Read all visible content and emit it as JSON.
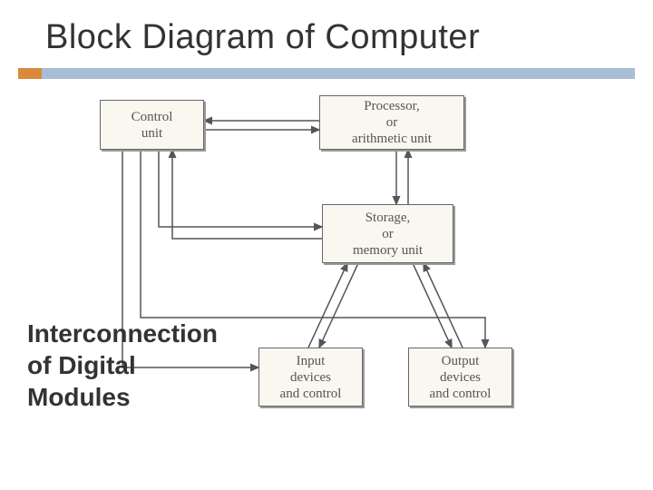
{
  "title": "Block Diagram of Computer",
  "subtitle": "Interconnection of Digital Modules",
  "blocks": {
    "control": "Control\nunit",
    "processor": "Processor,\nor\narithmetic unit",
    "storage": "Storage,\nor\nmemory unit",
    "input": "Input\ndevices\nand control",
    "output": "Output\ndevices\nand control"
  },
  "connections": [
    {
      "from": "processor",
      "to": "control",
      "bidirectional": true
    },
    {
      "from": "control",
      "to": "storage",
      "bidirectional": true
    },
    {
      "from": "control",
      "to": "input",
      "bidirectional": false
    },
    {
      "from": "control",
      "to": "output",
      "bidirectional": false
    },
    {
      "from": "processor",
      "to": "storage",
      "bidirectional": true
    },
    {
      "from": "storage",
      "to": "input",
      "bidirectional": true
    },
    {
      "from": "storage",
      "to": "output",
      "bidirectional": true
    }
  ]
}
